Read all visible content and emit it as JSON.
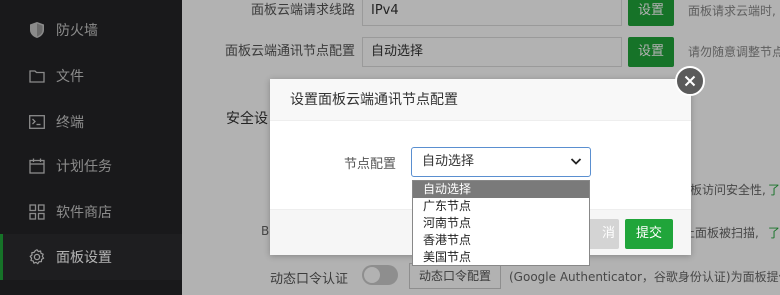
{
  "sidebar": {
    "items": [
      {
        "label": "防火墙",
        "icon": "shield-icon"
      },
      {
        "label": "文件",
        "icon": "folder-icon"
      },
      {
        "label": "终端",
        "icon": "terminal-icon"
      },
      {
        "label": "计划任务",
        "icon": "calendar-icon"
      },
      {
        "label": "软件商店",
        "icon": "grid-icon"
      },
      {
        "label": "面板设置",
        "icon": "gear-icon",
        "active": true
      }
    ]
  },
  "settings": {
    "rows": [
      {
        "label": "面板云端请求线路",
        "value": "IPv4",
        "button": "设置",
        "hint": "面板请求云端时,"
      },
      {
        "label": "面板云端通讯节点配置",
        "value": "自动选择",
        "button": "设置",
        "hint": "请勿随意调整节点"
      }
    ],
    "section_title_partial": "安全设",
    "bg_fragments": {
      "panel_security": "板访问安全性,",
      "panel_security_link": "了",
      "bind_partial": "B",
      "scan_text": "止面板被扫描,",
      "scan_link": "了"
    },
    "twofa": {
      "label": "动态口令认证",
      "button": "动态口令配置",
      "desc": "(Google Authenticator，谷歌身份认证)为面板提供"
    }
  },
  "dialog": {
    "title": "设置面板云端通讯节点配置",
    "form_label": "节点配置",
    "select_value": "自动选择",
    "options": [
      "自动选择",
      "广东节点",
      "河南节点",
      "香港节点",
      "美国节点"
    ],
    "selected_index": 0,
    "cancel_label": "消",
    "submit_label": "提交"
  },
  "colors": {
    "accent": "#20a53a",
    "sidebar_bg": "#242427",
    "overlay": "rgba(0,0,0,0.30)"
  }
}
